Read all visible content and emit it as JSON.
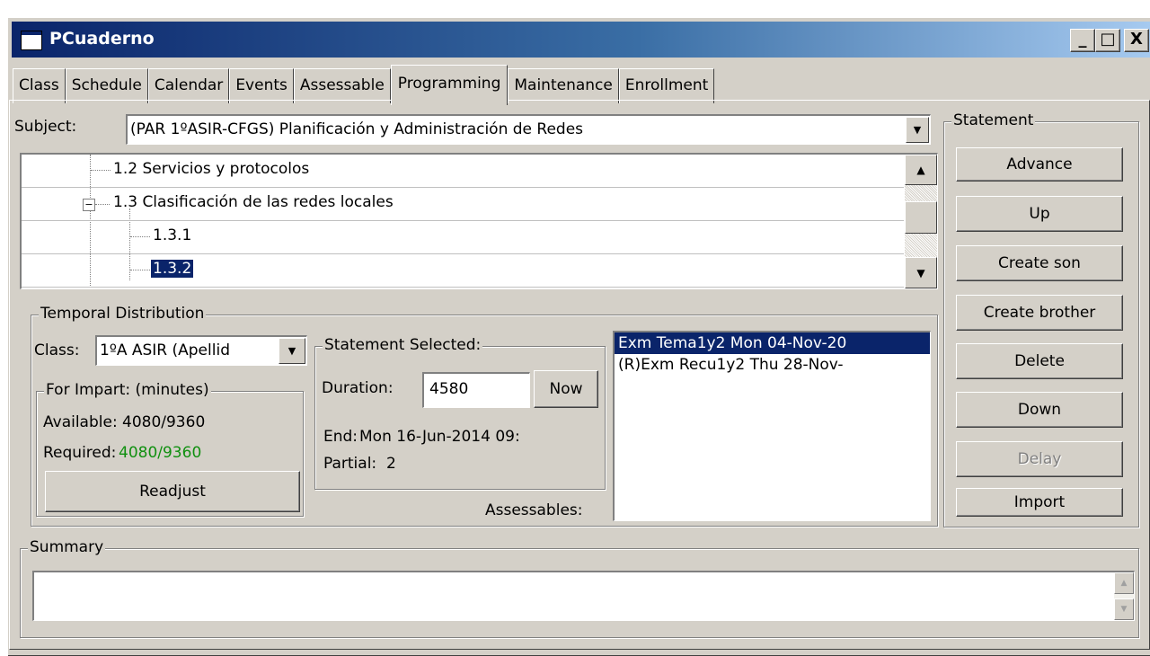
{
  "window": {
    "title": "PCuaderno",
    "minimize": "_",
    "maximize": "□",
    "close": "X"
  },
  "tabs": [
    {
      "label": "Class"
    },
    {
      "label": "Schedule"
    },
    {
      "label": "Calendar"
    },
    {
      "label": "Events"
    },
    {
      "label": "Assessable"
    },
    {
      "label": "Programming",
      "active": true
    },
    {
      "label": "Maintenance"
    },
    {
      "label": "Enrollment"
    }
  ],
  "subject": {
    "label": "Subject:",
    "value": "(PAR 1ºASIR-CFGS) Planificación y Administración de Redes"
  },
  "tree": {
    "items": [
      {
        "label": "1.2 Servicios y protocolos",
        "level": 1
      },
      {
        "label": "1.3 Clasificación de las redes locales",
        "level": 1,
        "expanded": true,
        "expander": "−"
      },
      {
        "label": "1.3.1",
        "level": 2
      },
      {
        "label": "1.3.2",
        "level": 2,
        "selected": true
      }
    ]
  },
  "statement_panel": {
    "title": "Statement",
    "buttons": {
      "advance": "Advance",
      "up": "Up",
      "create_son": "Create son",
      "create_brother": "Create brother",
      "delete": "Delete",
      "down": "Down",
      "delay": "Delay",
      "import": "Import"
    }
  },
  "temporal": {
    "title": "Temporal Distribution",
    "class_label": "Class:",
    "class_value": "1ºA ASIR (Apellid",
    "for_impart": {
      "title": "For Impart: (minutes)",
      "available_label": "Available:",
      "available_value": "4080/9360",
      "required_label": "Required:",
      "required_value": "4080/9360",
      "readjust": "Readjust"
    },
    "statement_selected": {
      "title": "Statement Selected:",
      "duration_label": "Duration:",
      "duration_value": "4580",
      "now": "Now",
      "end_label": "End:",
      "end_value": "Mon 16-Jun-2014 09:",
      "partial_label": "Partial:",
      "partial_value": "2"
    },
    "assessables_label": "Assessables:",
    "assessables": [
      {
        "text": "Exm Tema1y2 Mon 04-Nov-20",
        "selected": true
      },
      {
        "text": "(R)Exm Recu1y2 Thu 28-Nov-",
        "selected": false
      }
    ]
  },
  "summary": {
    "title": "Summary",
    "value": ""
  },
  "colors": {
    "face": "#d4d0c8",
    "selection": "#0a246a",
    "required_green": "#109010"
  }
}
